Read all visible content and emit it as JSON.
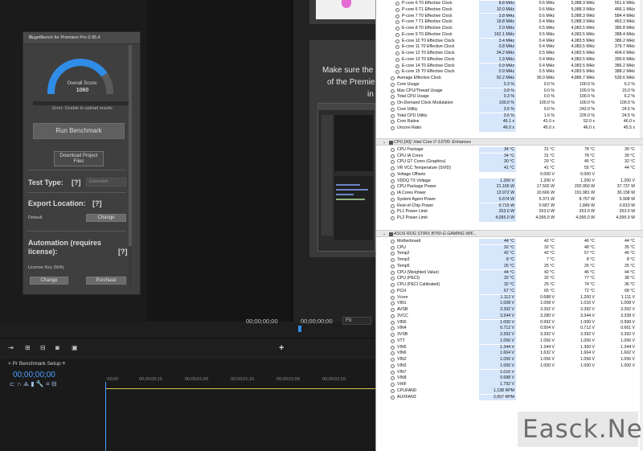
{
  "premiere": {
    "slide_lines": [
      "Make sure the",
      "of the Premie",
      "in t"
    ],
    "monitor_timecode_1": "00;00;00;00",
    "monitor_timecode_2": "00;00;00;00",
    "fit_label": "Fit",
    "timeline_tab": "Pr Benchmark Setup",
    "timeline_timecode": "00;00;00;00",
    "ruler_marks": [
      ":00;00",
      "00;00;00;15",
      "00;00;01;00",
      "00;00;01;15",
      "00;00;02;00",
      "00;00;02;15"
    ]
  },
  "puget": {
    "title": "PugetBench for Premiere Pro 0.95.4",
    "overall_label": "Overall Score:",
    "overall_score": "1060",
    "error_text": "Error: Unable to upload results",
    "run_button": "Run Benchmark",
    "download_button": "Download Project Files",
    "test_type_label": "Test Type:",
    "test_type_q": "[?]",
    "test_type_value": "Extended",
    "export_label": "Export Location:",
    "export_q": "[?]",
    "export_default": "Default",
    "change_label": "Change",
    "automation_label": "Automation (requires license):",
    "automation_q": "[?]",
    "license_label": "License Key (N/A)",
    "change2_label": "Change",
    "purchase_label": "Purchase"
  },
  "hwinfo": {
    "rows_top": [
      [
        "P-core 6 T0 Effective Clock",
        "8.8 MHz",
        "0.6 MHz",
        "5,088.3 MHz",
        "551.6 MHz"
      ],
      [
        "P-core 6 T1 Effective Clock",
        "10.0 MHz",
        "0.6 MHz",
        "5,088.3 MHz",
        "466.1 MHz"
      ],
      [
        "P-core 7 T0 Effective Clock",
        "3.8 MHz",
        "0.6 MHz",
        "5,088.3 MHz",
        "584.4 MHz"
      ],
      [
        "P-core 7 T1 Effective Clock",
        "19.8 MHz",
        "0.4 MHz",
        "5,088.3 MHz",
        "463.3 MHz"
      ],
      [
        "E-core 8 T0 Effective Clock",
        "2.0 MHz",
        "0.5 MHz",
        "4,083.5 MHz",
        "385.8 MHz"
      ],
      [
        "E-core 9 T0 Effective Clock",
        "162.1 MHz",
        "0.5 MHz",
        "4,083.5 MHz",
        "388.4 MHz"
      ],
      [
        "E-core 10 T0 Effective Clock",
        "3.4 MHz",
        "0.4 MHz",
        "4,083.5 MHz",
        "386.2 MHz"
      ],
      [
        "E-core 11 T0 Effective Clock",
        "0.8 MHz",
        "0.4 MHz",
        "4,083.5 MHz",
        "379.7 MHz"
      ],
      [
        "E-core 12 T0 Effective Clock",
        "34.2 MHz",
        "0.5 MHz",
        "4,083.5 MHz",
        "404.0 MHz"
      ],
      [
        "E-core 13 T0 Effective Clock",
        "1.9 MHz",
        "0.4 MHz",
        "4,083.5 MHz",
        "390.6 MHz"
      ],
      [
        "E-core 14 T0 Effective Clock",
        "0.9 MHz",
        "0.4 MHz",
        "4,083.5 MHz",
        "386.2 MHz"
      ],
      [
        "E-core 15 T0 Effective Clock",
        "0.9 MHz",
        "0.5 MHz",
        "4,083.5 MHz",
        "388.2 MHz"
      ],
      [
        "Average Effective Clock",
        "92.2 MHz",
        "36.0 MHz",
        "4,886.7 MHz",
        "539.6 MHz"
      ],
      [
        "Core Usage",
        "0.3 %",
        "0.0 %",
        "100.0 %",
        "6.2 %"
      ],
      [
        "Max CPU/Thread Usage",
        "3.8 %",
        "0.0 %",
        "100.0 %",
        "15.0 %"
      ],
      [
        "Total CPU Usage",
        "0.3 %",
        "0.0 %",
        "100.0 %",
        "6.2 %"
      ],
      [
        "On-Demand Clock Modulation",
        "100.0 %",
        "100.0 %",
        "100.0 %",
        "100.0 %"
      ],
      [
        "Core Utility",
        "3.6 %",
        "0.0 %",
        "242.0 %",
        "24.5 %"
      ],
      [
        "Total CPU Utility",
        "3.6 %",
        "1.6 %",
        "226.0 %",
        "24.5 %"
      ],
      [
        "Core Ratios",
        "46.1 x",
        "41.0 x",
        "52.0 x",
        "46.0 x"
      ],
      [
        "Uncore Ratio",
        "46.0 x",
        "45.0 x",
        "46.0 x",
        "45.5 x"
      ]
    ],
    "group1": "CPU [#0]: Intel Core i7-13700: Enhances",
    "rows_g1": [
      [
        "CPU Package",
        "34 °C",
        "31 °C",
        "78 °C",
        "39 °C"
      ],
      [
        "CPU IA Cores",
        "34 °C",
        "31 °C",
        "78 °C",
        "39 °C"
      ],
      [
        "CPU GT Cores (Graphics)",
        "30 °C",
        "29 °C",
        "45 °C",
        "32 °C"
      ],
      [
        "VR VCC Temperature (SVID)",
        "41 °C",
        "41 °C",
        "55 °C",
        "44 °C"
      ],
      [
        "Voltage Offsets",
        "",
        "0.000 V",
        "0.000 V",
        ""
      ],
      [
        "VDDQ TX Voltage",
        "1.200 V",
        "1.200 V",
        "1.200 V",
        "1.200 V"
      ],
      [
        "CPU Package Power",
        "21.165 W",
        "17.502 W",
        "202.950 W",
        "37.737 W"
      ],
      [
        "IA Cores Power",
        "13.972 W",
        "10.666 W",
        "191.981 W",
        "30.158 W"
      ],
      [
        "System Agent Power",
        "5.674 W",
        "5.371 W",
        "8.757 W",
        "5.908 W"
      ],
      [
        "Rest-of-Chip Power",
        "0.715 W",
        "0.687 W",
        "1.849 W",
        "0.810 W"
      ],
      [
        "PL1 Power Limit",
        "253.0 W",
        "253.0 W",
        "253.0 W",
        "253.0 W"
      ],
      [
        "PL2 Power Limit",
        "4,095.0 W",
        "4,095.0 W",
        "4,095.0 W",
        "4,095.0 W"
      ]
    ],
    "group2": "ASUS ROG STRIX B760-G GAMING WIF...",
    "rows_g2": [
      [
        "Motherboard",
        "44 °C",
        "42 °C",
        "46 °C",
        "44 °C"
      ],
      [
        "CPU",
        "32 °C",
        "32 °C",
        "48 °C",
        "35 °C"
      ],
      [
        "Temp2",
        "42 °C",
        "42 °C",
        "57 °C",
        "45 °C"
      ],
      [
        "Temp3",
        "8 °C",
        "7 °C",
        "8 °C",
        "8 °C"
      ],
      [
        "Temp5",
        "25 °C",
        "25 °C",
        "25 °C",
        "25 °C"
      ],
      [
        "CPU (Weighted Value)",
        "44 °C",
        "42 °C",
        "46 °C",
        "44 °C"
      ],
      [
        "CPU (PECI)",
        "32 °C",
        "32 °C",
        "77 °C",
        "38 °C"
      ],
      [
        "CPU (PECI Calibrated)",
        "32 °C",
        "25 °C",
        "74 °C",
        "36 °C"
      ],
      [
        "PCH",
        "67 °C",
        "65 °C",
        "72 °C",
        "68 °C"
      ],
      [
        "Vcore",
        "1.112 V",
        "0.688 V",
        "1.200 V",
        "1.111 V"
      ],
      [
        "VIN1",
        "1.008 V",
        "1.008 V",
        "1.016 V",
        "1.008 V"
      ],
      [
        "AVSB",
        "3.392 V",
        "3.392 V",
        "3.392 V",
        "3.392 V"
      ],
      [
        "3VCC",
        "3.344 V",
        "3.280 V",
        "3.344 V",
        "3.338 V"
      ],
      [
        "VIN0",
        "1.000 V",
        "0.992 V",
        "1.000 V",
        "0.999 V"
      ],
      [
        "VIN4",
        "0.712 V",
        "0.504 V",
        "0.712 V",
        "0.661 V"
      ],
      [
        "3VSB",
        "3.392 V",
        "3.392 V",
        "3.392 V",
        "3.392 V"
      ],
      [
        "VTT",
        "1.056 V",
        "1.056 V",
        "1.056 V",
        "1.056 V"
      ],
      [
        "VIN5",
        "1.344 V",
        "1.344 V",
        "1.360 V",
        "1.344 V"
      ],
      [
        "VIN6",
        "1.664 V",
        "1.632 V",
        "1.664 V",
        "1.662 V"
      ],
      [
        "VIN2",
        "1.056 V",
        "1.056 V",
        "1.056 V",
        "1.056 V"
      ],
      [
        "VIN3",
        "1.000 V",
        "1.000 V",
        "1.000 V",
        "1.000 V"
      ],
      [
        "VIN7",
        "1.016 V",
        "",
        "",
        ""
      ],
      [
        "VIN8",
        "0.688 V",
        "",
        "",
        ""
      ],
      [
        "VHIF",
        "1.792 V",
        "",
        "",
        ""
      ],
      [
        "CPUFAN0",
        "1,138 RPM",
        "",
        "",
        ""
      ],
      [
        "AUXFAN3",
        "2,657 RPM",
        "",
        "",
        ""
      ]
    ]
  },
  "watermark": "Easck.Net"
}
